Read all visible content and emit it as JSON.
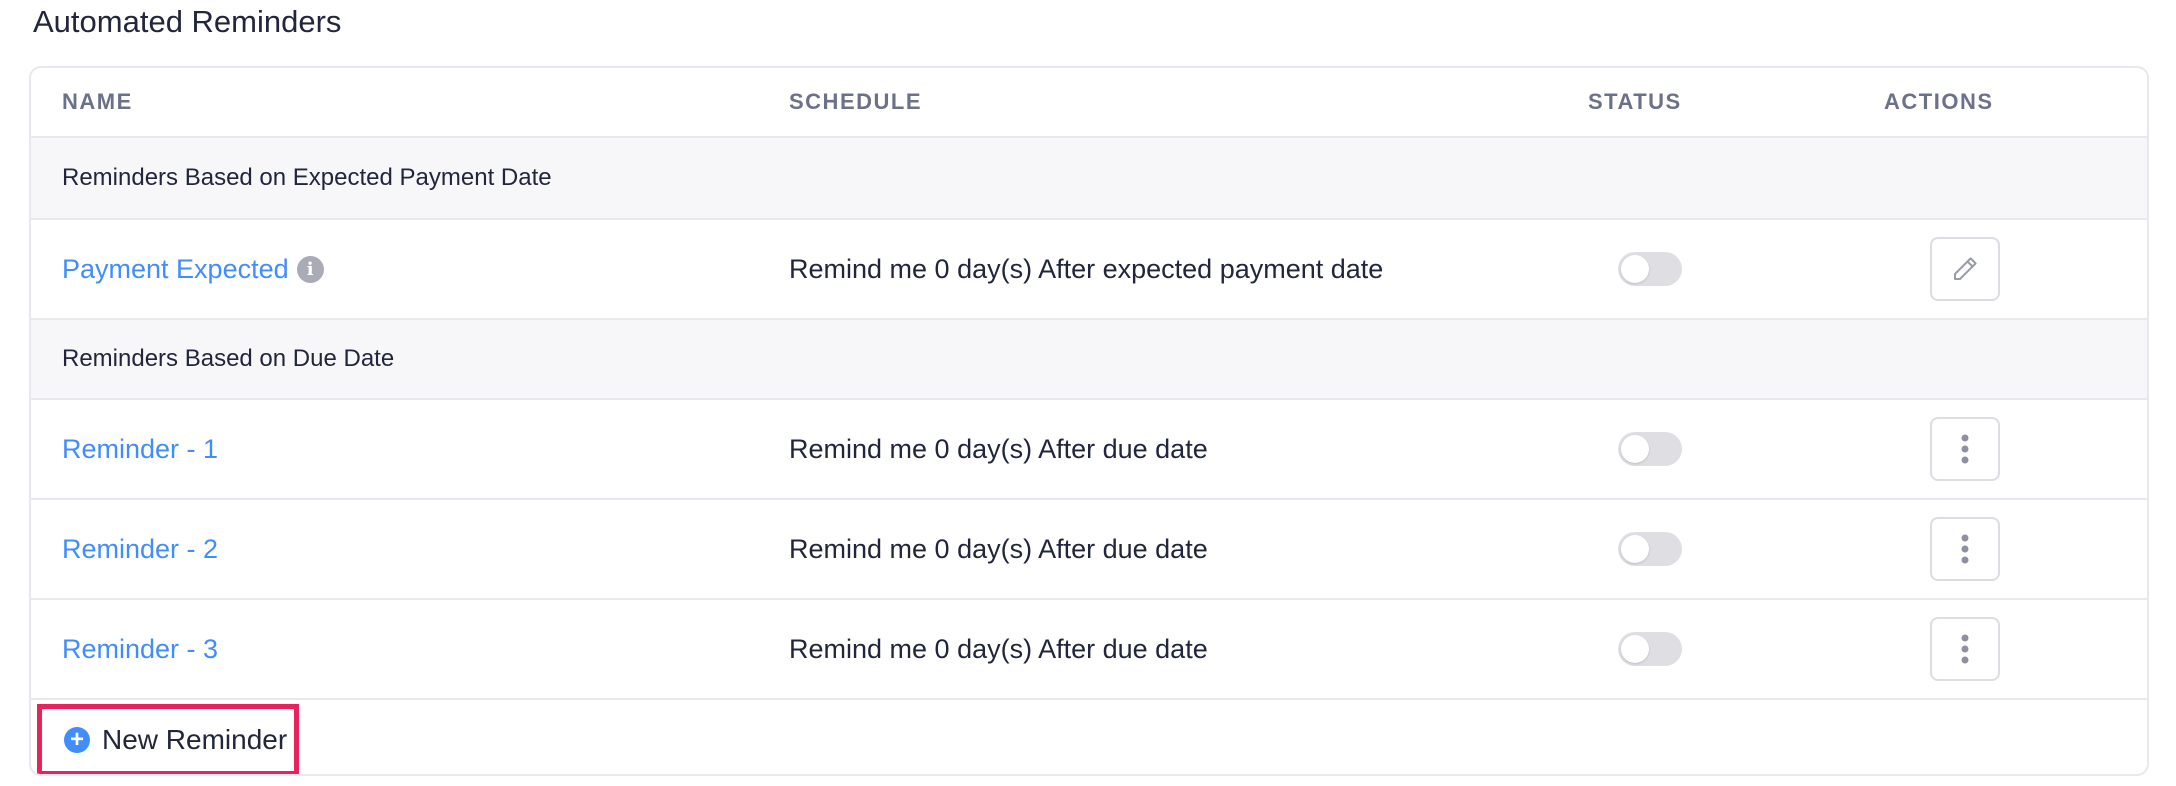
{
  "page": {
    "title": "Automated Reminders"
  },
  "table": {
    "headers": {
      "name": "NAME",
      "schedule": "SCHEDULE",
      "status": "STATUS",
      "actions": "ACTIONS"
    },
    "groups": [
      {
        "label": "Reminders Based on Expected Payment Date",
        "rows": [
          {
            "name": "Payment Expected",
            "schedule": "Remind me 0 day(s) After expected payment date",
            "enabled": false,
            "action_icon": "pencil-icon",
            "has_info": true
          }
        ]
      },
      {
        "label": "Reminders Based on Due Date",
        "rows": [
          {
            "name": "Reminder - 1",
            "schedule": "Remind me 0 day(s) After due date",
            "enabled": false,
            "action_icon": "more-vertical-icon"
          },
          {
            "name": "Reminder - 2",
            "schedule": "Remind me 0 day(s) After due date",
            "enabled": false,
            "action_icon": "more-vertical-icon"
          },
          {
            "name": "Reminder - 3",
            "schedule": "Remind me 0 day(s) After due date",
            "enabled": false,
            "action_icon": "more-vertical-icon"
          }
        ]
      }
    ]
  },
  "footer": {
    "new_label": "New Reminder",
    "icon": "plus-circle-icon"
  },
  "colors": {
    "link": "#408dfb",
    "highlight": "#e8235b",
    "toggle_off": "#dedee3"
  }
}
